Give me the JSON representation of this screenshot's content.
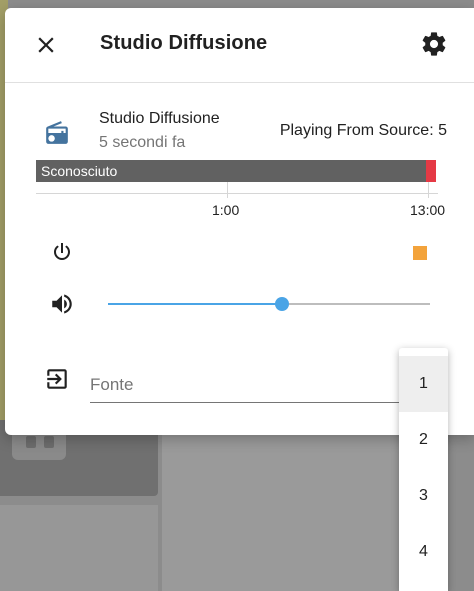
{
  "dialog": {
    "title": "Studio Diffusione"
  },
  "entity": {
    "name": "Studio Diffusione",
    "last_changed": "5 secondi fa",
    "playing_from": "Playing From Source: 5"
  },
  "timeline": {
    "bar_label": "Sconosciuto",
    "ticks": [
      "1:00",
      "13:00"
    ]
  },
  "state_color": "#f3a33b",
  "accent_color": "#4aa4e6",
  "volume": {
    "level_percent": 54
  },
  "source": {
    "placeholder": "Fonte",
    "options": [
      "1",
      "2",
      "3",
      "4"
    ],
    "highlighted_option": "1"
  },
  "icons": {
    "close": "close-icon",
    "settings": "gear-icon",
    "entity": "radio-icon",
    "power": "power-icon",
    "volume": "volume-high-icon",
    "source": "login-variant-icon"
  }
}
